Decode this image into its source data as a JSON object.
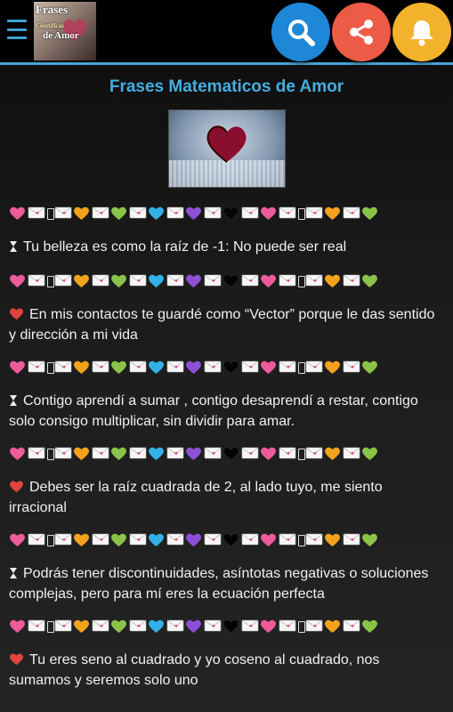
{
  "header": {
    "logo_lines": [
      "Frases",
      "Científicas",
      "de Amor"
    ],
    "actions": [
      "search-icon",
      "share-icon",
      "bell-icon"
    ],
    "colors": {
      "search": "#1f87d7",
      "share": "#ec5b45",
      "bell": "#f3b22b",
      "accent": "#45aee0"
    }
  },
  "page": {
    "title": "Frases Matematicos de Amor"
  },
  "divider_sequence": [
    "pink",
    "env",
    "hg",
    "env",
    "orange",
    "env",
    "green",
    "env",
    "blue",
    "env",
    "purple",
    "env",
    "black",
    "env",
    "pink",
    "env",
    "hg",
    "env",
    "orange",
    "env",
    "green"
  ],
  "phrases": [
    {
      "marker": "hourglass",
      "text": "Tu belleza es como la raíz de -1: No puede ser real"
    },
    {
      "marker": "heart",
      "text": "En mis contactos te guardé como “Vector” porque le das sentido y dirección a mi vida"
    },
    {
      "marker": "hourglass",
      "text": "Contigo aprendí a sumar , contigo desaprendí a restar, contigo solo consigo multiplicar, sin dividir para amar."
    },
    {
      "marker": "heart",
      "text": "Debes ser la raíz cuadrada de 2, al lado tuyo, me siento irracional"
    },
    {
      "marker": "hourglass",
      "text": "Podrás tener discontinuidades, asíntotas negativas o soluciones complejas, pero para mí eres la ecuación perfecta"
    },
    {
      "marker": "heart",
      "text": "Tu eres seno al cuadrado y yo coseno al cuadrado, nos sumamos y seremos solo uno"
    }
  ]
}
